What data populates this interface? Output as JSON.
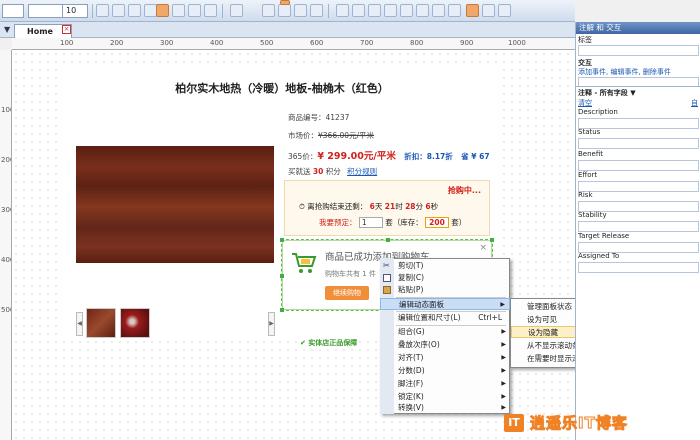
{
  "toolbar": {
    "font_size": "10"
  },
  "tabs": {
    "home": "Home"
  },
  "rulers": {
    "top": [
      "100",
      "200",
      "300",
      "400",
      "500",
      "600",
      "700",
      "800",
      "900",
      "1000"
    ],
    "left": [
      "100",
      "200",
      "300",
      "400",
      "500"
    ]
  },
  "product": {
    "title": "柏尔实木地热（冷暖）地板-柚桷木（红色）",
    "code_label": "商品编号：",
    "code": "41237",
    "market_label": "市场价：",
    "market_price": "¥366.00元/平米",
    "price_label": "365价：",
    "price": "¥ 299.00元/平米",
    "discount": "折扣：8.17折",
    "save": "省 ¥ 67",
    "points_prefix": "买就送",
    "points": "30",
    "points_suffix": "积分",
    "points_rule": "积分规则"
  },
  "panic": {
    "title": "抢购中...",
    "countdown_prefix": "离抢购结束还剩：",
    "days": "6",
    "days_unit": "天",
    "hours": "21",
    "hours_unit": "时",
    "minutes": "28",
    "minutes_unit": "分",
    "seconds": "6",
    "seconds_unit": "秒",
    "reserve_label": "我要预定：",
    "qty": "1",
    "stock_label": "套（库存：",
    "stock": "200",
    "stock_suffix": "套）"
  },
  "popup": {
    "message": "商品已成功添加到购物车",
    "count_text": "购物车共有 1 件",
    "continue": "继续购物",
    "close": "×"
  },
  "guarantee": "实体店正品保障",
  "context_menu": [
    {
      "label": "剪切(T)",
      "icon": "scissors-icon"
    },
    {
      "label": "复制(C)",
      "icon": "copy-icon"
    },
    {
      "label": "粘贴(P)",
      "icon": "paste-icon"
    },
    {
      "label": "编辑动态面板",
      "submenu": true
    },
    {
      "label": "编辑位置和尺寸(L)",
      "shortcut": "Ctrl+L"
    },
    {
      "label": "组合(G)",
      "submenu": true
    },
    {
      "label": "叠放次序(O)",
      "submenu": true
    },
    {
      "label": "对齐(T)",
      "submenu": true
    },
    {
      "label": "分数(D)",
      "submenu": true
    },
    {
      "label": "脚注(F)",
      "submenu": true
    },
    {
      "label": "锁定(K)",
      "submenu": true
    },
    {
      "label": "转换(V)",
      "submenu": true
    }
  ],
  "sub_menu": [
    {
      "label": "管理面板状态"
    },
    {
      "label": "设为可见"
    },
    {
      "label": "设为隐藏"
    },
    {
      "label": "从不显示滚动条"
    },
    {
      "label": "在需要时显示滚动条"
    }
  ],
  "right_panel": {
    "title": "注解 和 交互",
    "label_heading": "标签",
    "interaction_heading": "交互",
    "add_event": "添加事件",
    "edit_event": "编辑事件",
    "delete_event": "删除事件",
    "notes_heading": "注释 - 所有字段",
    "clear": "清空",
    "custom": "自",
    "fields": [
      "Description",
      "Status",
      "Benefit",
      "Effort",
      "Risk",
      "Stability",
      "Target Release",
      "Assigned To"
    ]
  },
  "watermark": {
    "badge": "IT",
    "text": "逍遥乐IT博客"
  },
  "colors": {
    "accent": "#f08226",
    "price_red": "#d0211c",
    "link_blue": "#1a57b3",
    "selection_green": "#3cb33c"
  }
}
